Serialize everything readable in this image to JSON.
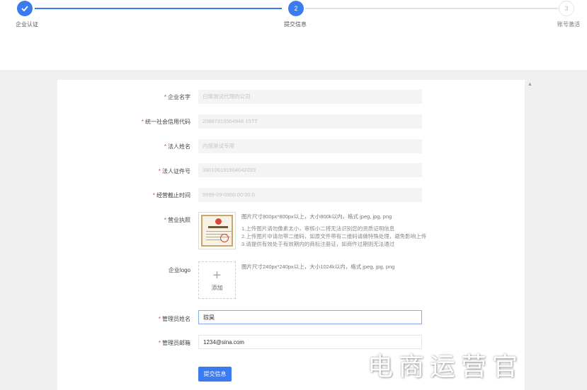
{
  "stepper": {
    "steps": [
      {
        "label": "企业认证",
        "number": "",
        "status": "done"
      },
      {
        "label": "提交信息",
        "number": "2",
        "status": "current"
      },
      {
        "label": "账号激活",
        "number": "3",
        "status": "todo"
      }
    ],
    "accent_color": "#3a7cf0"
  },
  "form": {
    "company_name": {
      "label": "企业名字",
      "required": true,
      "value": "白璨测试代理的公司"
    },
    "credit_code": {
      "label": "统一社会信用代码",
      "required": true,
      "value": "20887315564946 15TT"
    },
    "legal_name": {
      "label": "法人姓名",
      "required": true,
      "value": "内部测试专用"
    },
    "legal_id": {
      "label": "法人证件号",
      "required": true,
      "value": "330106191804042033"
    },
    "end_time": {
      "label": "经营截止时间",
      "required": true,
      "value": "9999-09-0900:00:00.0"
    },
    "license": {
      "label": "营业执照",
      "required": true,
      "hint": "图片尺寸800px*800px以上，大小800k以内，格式 jpeg, jpg, png",
      "notes": [
        "1.上传图片请勿像素太小，审核小二将无法识别您的资质证明信息",
        "2.上传图片中请勿带二维码，如原文件带有二维码请做特殊处理，避免影响上传",
        "3.请提供有效处于有效期内的商标注册证，如商件过期则无法通过"
      ]
    },
    "logo": {
      "label": "企业logo",
      "required": false,
      "hint": "图片尺寸240px*240px以上，大小1024k以内，格式 jpeg, jpg, png",
      "upload_icon": "plus-icon",
      "upload_text": "添加"
    },
    "admin_name": {
      "label": "管理员姓名",
      "required": true,
      "value": "琮昊"
    },
    "admin_email": {
      "label": "管理员邮箱",
      "required": true,
      "value": "1234@sina.com"
    },
    "required_mark": "*",
    "submit_label": "提交信息"
  },
  "watermark": "电商运营官"
}
